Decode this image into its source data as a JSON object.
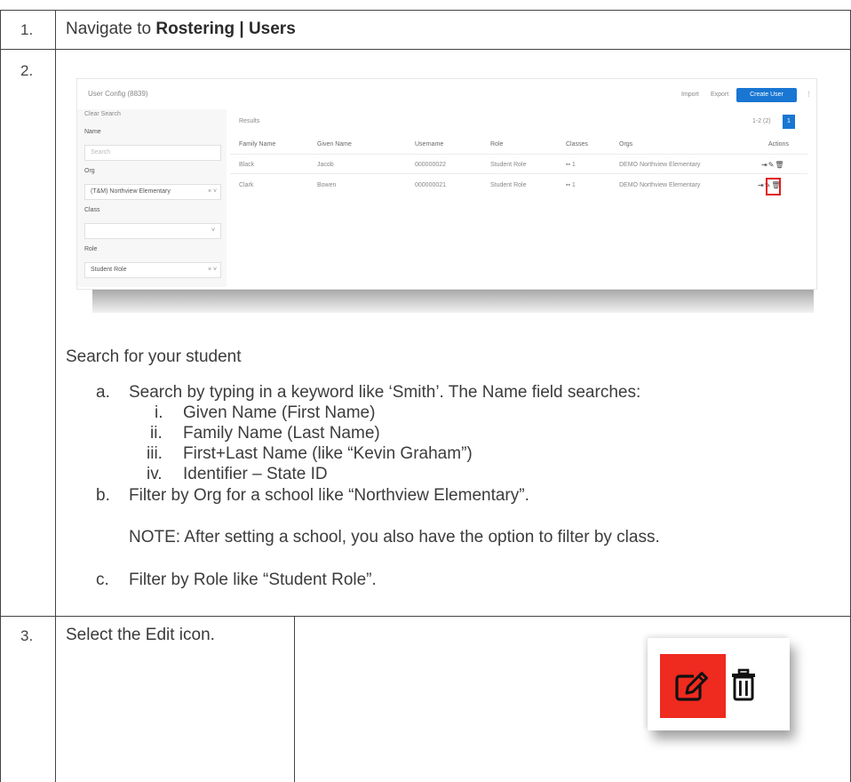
{
  "steps": [
    {
      "number": "1.",
      "text_prefix": "Navigate to ",
      "text_bold": "Rostering | Users"
    },
    {
      "number": "2.",
      "screenshot": {
        "title": "User Config (8839)",
        "links": [
          "Import",
          "Export"
        ],
        "create_button": "Create User",
        "clear_search": "Clear Search",
        "filters": [
          {
            "label": "Name",
            "value": "Search"
          },
          {
            "label": "Org",
            "value": "(T&M) Northview Elementary"
          },
          {
            "label": "Class",
            "value": ""
          },
          {
            "label": "Role",
            "value": "Student Role"
          }
        ],
        "results_label": "Results",
        "pagination_text": "1-2 (2)",
        "page_number": "1",
        "columns": [
          "Family Name",
          "Given Name",
          "Username",
          "Role",
          "Classes",
          "Orgs",
          "Actions"
        ],
        "rows": [
          [
            "Black",
            "Jacob",
            "000000022",
            "Student Role",
            "1",
            "DEMO Northview Elementary"
          ],
          [
            "Clark",
            "Bowen",
            "000000021",
            "Student Role",
            "1",
            "DEMO Northview Elementary"
          ]
        ]
      },
      "intro": "Search for your student",
      "items": [
        {
          "marker": "a.",
          "text": "Search by typing in a keyword like ‘Smith’. The Name field searches:"
        },
        {
          "marker": "i.",
          "text": "Given Name (First Name)"
        },
        {
          "marker": "ii.",
          "text": "Family Name (Last Name)"
        },
        {
          "marker": "iii.",
          "text": "First+Last Name (like “Kevin Graham”)"
        },
        {
          "marker": "iv.",
          "text": "Identifier – State ID"
        },
        {
          "marker": "b.",
          "text": "Filter by Org for a school like “Northview Elementary”."
        },
        {
          "marker": "",
          "text": "NOTE: After setting a school, you also have the option to filter by class."
        },
        {
          "marker": "c.",
          "text": "Filter by Role like “Student Role”."
        }
      ]
    },
    {
      "number": "3.",
      "text": "Select the Edit icon."
    }
  ],
  "colors": {
    "highlight": "#ef2a1f",
    "primary_button": "#1976d2",
    "grid_lines": "#444444"
  },
  "icons": [
    "edit-icon",
    "trash-icon",
    "login-icon",
    "classes-icon",
    "chevron-down-icon"
  ]
}
